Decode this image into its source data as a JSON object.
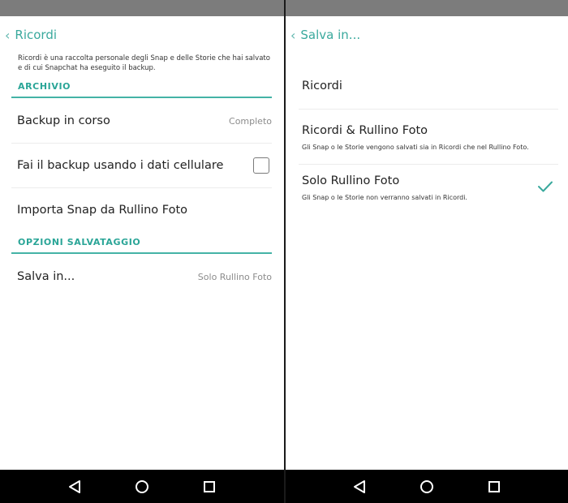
{
  "left": {
    "header": {
      "back_icon": "chevron-left-icon",
      "title": "Ricordi"
    },
    "description": "Ricordi è una raccolta personale degli Snap e delle Storie che hai salvato e di cui Snapchat ha eseguito il backup.",
    "sections": {
      "archivio": {
        "label": "ARCHIVIO",
        "rows": {
          "backup": {
            "label": "Backup in corso",
            "value": "Completo"
          },
          "cellular": {
            "label": "Fai il backup usando i dati cellulare",
            "checked": false
          },
          "import": {
            "label": "Importa Snap da Rullino Foto"
          }
        }
      },
      "opzioni": {
        "label": "OPZIONI SALVATAGGIO",
        "rows": {
          "save_in": {
            "label": "Salva in...",
            "value": "Solo Rullino Foto"
          }
        }
      }
    }
  },
  "right": {
    "header": {
      "back_icon": "chevron-left-icon",
      "title": "Salva in..."
    },
    "options": [
      {
        "title": "Ricordi",
        "subtitle": "",
        "selected": false
      },
      {
        "title": "Ricordi & Rullino Foto",
        "subtitle": "Gli Snap o le Storie vengono salvati sia in Ricordi che nel Rullino Foto.",
        "selected": false
      },
      {
        "title": "Solo Rullino Foto",
        "subtitle": "Gli Snap o le Storie non verranno salvati in Ricordi.",
        "selected": true
      }
    ]
  },
  "nav": {
    "icons": [
      "back-triangle-icon",
      "home-circle-icon",
      "recents-square-icon"
    ]
  },
  "colors": {
    "accent": "#3aa99d",
    "nav_bar": "#000000",
    "status_bar": "#7c7c7c"
  }
}
